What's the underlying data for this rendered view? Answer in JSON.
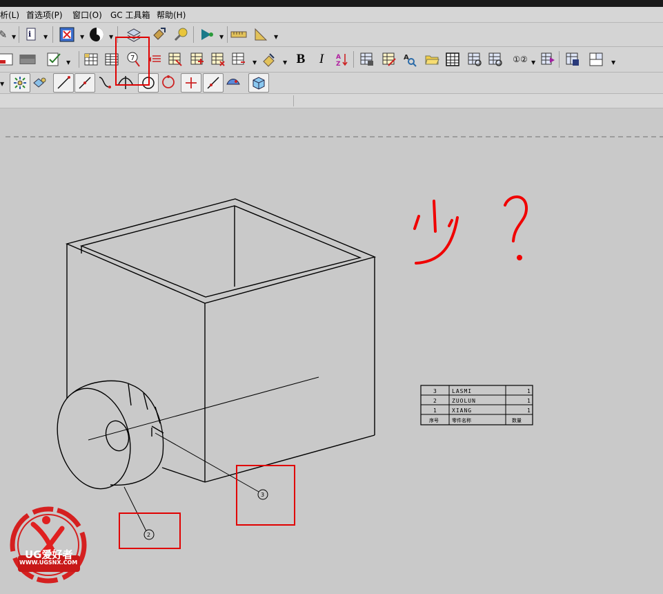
{
  "menu": {
    "items": [
      {
        "label": "析(L)"
      },
      {
        "label": "首选项(P)"
      },
      {
        "label": "窗口(O)"
      },
      {
        "label": "GC 工具箱"
      },
      {
        "label": "帮助(H)"
      }
    ]
  },
  "toolbar": {
    "bold_label": "B",
    "italic_label": "I",
    "balloon_label": "7",
    "balloons_label": "①②"
  },
  "drawing": {
    "balloons": [
      "3",
      "2"
    ],
    "annotation": "少 ?",
    "parts_list": {
      "header": [
        "序号",
        "零件名称",
        "数量"
      ],
      "rows": [
        [
          "3",
          "LASMI",
          "1"
        ],
        [
          "2",
          "ZUOLUN",
          "1"
        ],
        [
          "1",
          "XIANG",
          "1"
        ]
      ]
    }
  },
  "watermark": {
    "brand": "UG爱好者",
    "url": "WWW.UGSNX.COM"
  },
  "colors": {
    "highlight": "#e00000",
    "canvas": "#c9c9c9",
    "toolbar": "#d4d4d4"
  }
}
